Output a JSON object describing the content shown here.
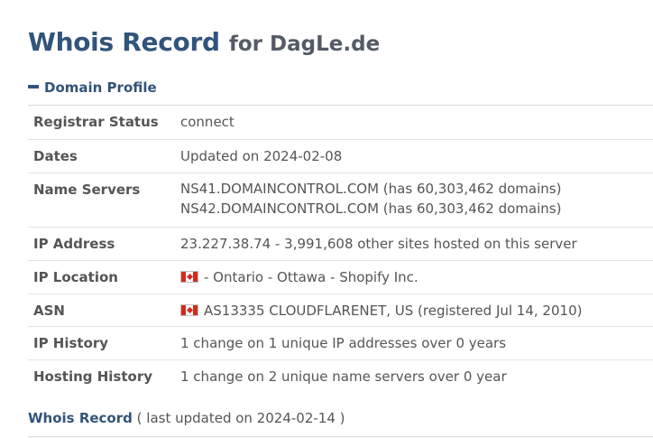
{
  "header": {
    "title": "Whois Record",
    "subtitle": "for DagLe.de"
  },
  "section": {
    "label": "Domain Profile",
    "icon": "collapse-dash-icon"
  },
  "profile": {
    "registrar_status": {
      "label": "Registrar Status",
      "value": "connect"
    },
    "dates": {
      "label": "Dates",
      "value": "Updated on 2024-02-08"
    },
    "name_servers": {
      "label": "Name Servers",
      "values": [
        "NS41.DOMAINCONTROL.COM (has 60,303,462 domains)",
        "NS42.DOMAINCONTROL.COM (has 60,303,462 domains)"
      ]
    },
    "ip_address": {
      "label": "IP Address",
      "value": "23.227.38.74 - 3,991,608 other sites hosted on this server"
    },
    "ip_location": {
      "label": "IP Location",
      "value": "- Ontario - Ottawa - Shopify Inc.",
      "flag": "canada-flag-icon"
    },
    "asn": {
      "label": "ASN",
      "value": "AS13335 CLOUDFLARENET, US (registered Jul 14, 2010)",
      "flag": "canada-flag-icon"
    },
    "ip_history": {
      "label": "IP History",
      "value": "1 change on 1 unique IP addresses over 0 years"
    },
    "hosting_history": {
      "label": "Hosting History",
      "value": "1 change on 2 unique name servers over 0 year"
    }
  },
  "whois": {
    "label": "Whois Record",
    "meta": "( last updated on 2024-02-14 )"
  },
  "colors": {
    "accent": "#31547a",
    "text": "#555555",
    "divider": "#e4e4e4"
  }
}
